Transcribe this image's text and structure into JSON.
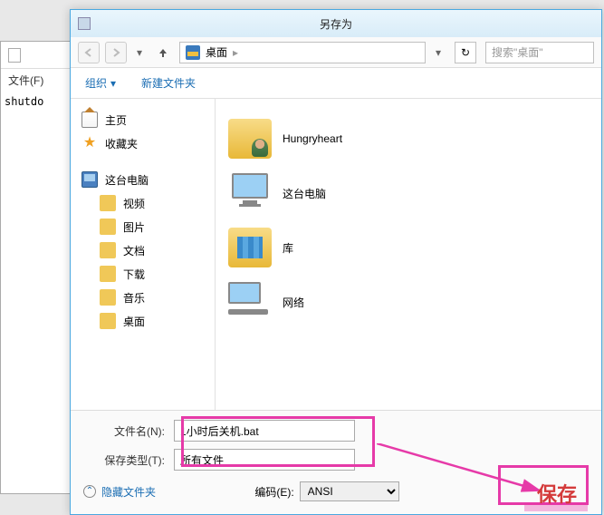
{
  "bg": {
    "menu_file": "文件(F)",
    "content": "shutdo"
  },
  "dialog": {
    "title": "另存为"
  },
  "nav": {
    "location": "桌面",
    "location_sep": "▸",
    "refresh_icon": "↻",
    "search_placeholder": "搜索\"桌面\""
  },
  "toolbar": {
    "organize": "组织",
    "organize_arrow": "▾",
    "new_folder": "新建文件夹"
  },
  "sidebar": {
    "home": "主页",
    "favorites": "收藏夹",
    "this_pc": "这台电脑",
    "videos": "视频",
    "pictures": "图片",
    "documents": "文档",
    "downloads": "下载",
    "music": "音乐",
    "desktop": "桌面"
  },
  "files": {
    "items": [
      {
        "label": "Hungryheart"
      },
      {
        "label": "这台电脑"
      },
      {
        "label": "库"
      },
      {
        "label": "网络"
      }
    ]
  },
  "form": {
    "filename_label": "文件名(N):",
    "filename_value": "1小时后关机.bat",
    "filetype_label": "保存类型(T):",
    "filetype_value": "所有文件"
  },
  "footer": {
    "hide_folders": "隐藏文件夹",
    "hide_icon": "⌃",
    "encoding_label": "编码(E):",
    "encoding_value": "ANSI"
  },
  "marker": {
    "save_text": "保存"
  }
}
